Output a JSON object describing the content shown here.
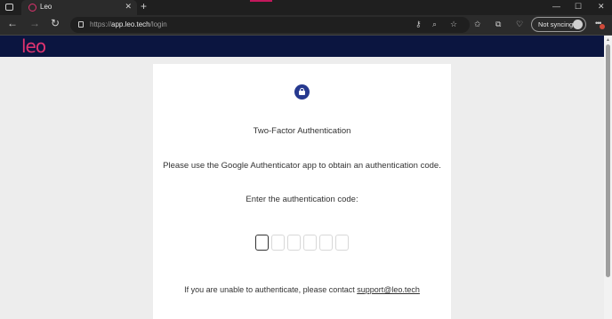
{
  "browser": {
    "tab_title": "Leo",
    "tab_close": "✕",
    "new_tab": "+",
    "url_prefix": "https://",
    "url_host": "app.leo.tech",
    "url_path": "/login",
    "sync_label": "Not syncing",
    "window": {
      "minimize": "—",
      "maximize": "☐",
      "close": "✕"
    },
    "icons": [
      "key-icon",
      "zoom-icon",
      "favorite-add-icon",
      "favorites-icon",
      "collections-icon",
      "performance-icon"
    ]
  },
  "app": {
    "logo": "leo",
    "brand_color": "#e0336f",
    "header_color": "#0b1540"
  },
  "auth": {
    "icon": "lock-icon",
    "title": "Two-Factor Authentication",
    "instructions": "Please use the Google Authenticator app to obtain an authentication code.",
    "prompt": "Enter the authentication code:",
    "code_digits": [
      "",
      "",
      "",
      "",
      "",
      ""
    ],
    "help_text": "If you are unable to authenticate, please contact ",
    "support_email": "support@leo.tech"
  }
}
